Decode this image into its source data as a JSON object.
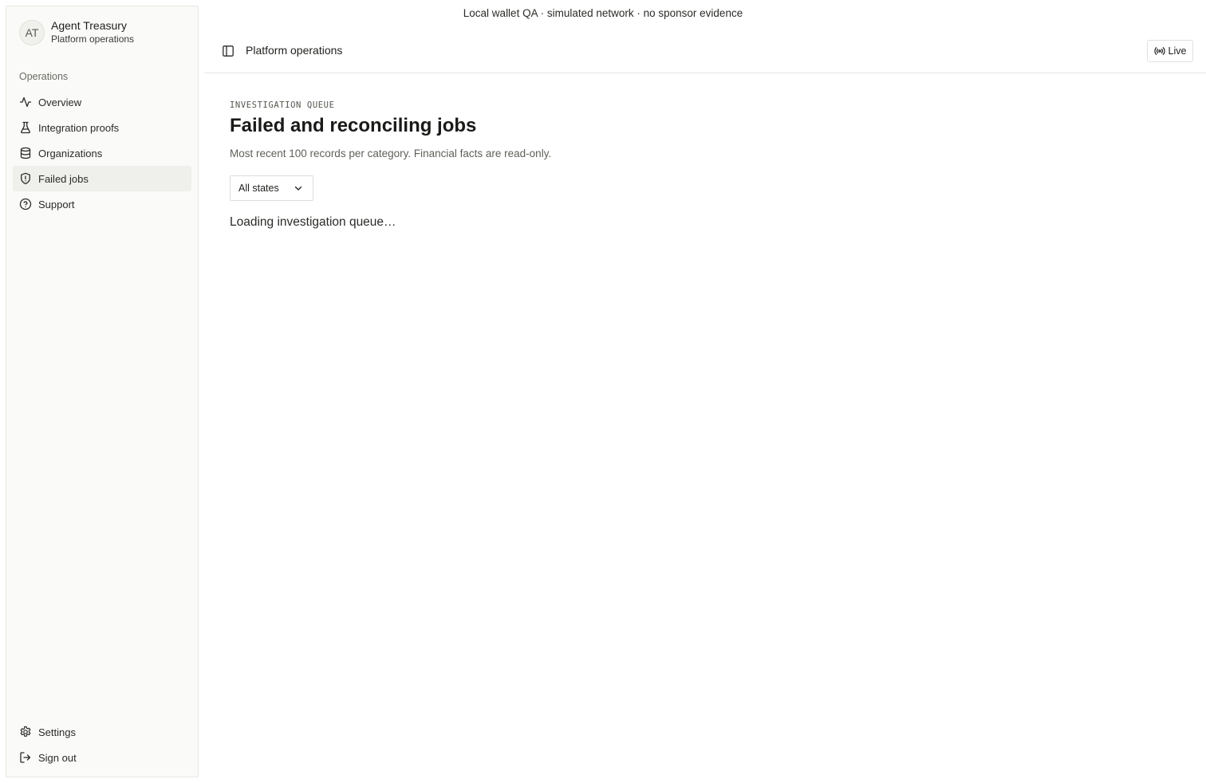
{
  "topnote": "Local wallet QA · simulated network · no sponsor evidence",
  "brand": {
    "initials": "AT",
    "name": "Agent Treasury",
    "subtitle": "Platform operations"
  },
  "sidebar": {
    "group_label": "Operations",
    "items": [
      {
        "label": "Overview",
        "icon": "activity-icon"
      },
      {
        "label": "Integration proofs",
        "icon": "flask-icon"
      },
      {
        "label": "Organizations",
        "icon": "database-icon"
      },
      {
        "label": "Failed jobs",
        "icon": "shield-alert-icon",
        "active": true
      },
      {
        "label": "Support",
        "icon": "help-circle-icon"
      }
    ],
    "bottom_items": [
      {
        "label": "Settings",
        "icon": "gear-icon"
      },
      {
        "label": "Sign out",
        "icon": "sign-out-icon"
      }
    ]
  },
  "header": {
    "title": "Platform operations",
    "live_label": "Live"
  },
  "main": {
    "eyebrow": "INVESTIGATION QUEUE",
    "title": "Failed and reconciling jobs",
    "description": "Most recent 100 records per category. Financial facts are read-only.",
    "state_filter": "All states",
    "loading_text": "Loading investigation queue…"
  }
}
